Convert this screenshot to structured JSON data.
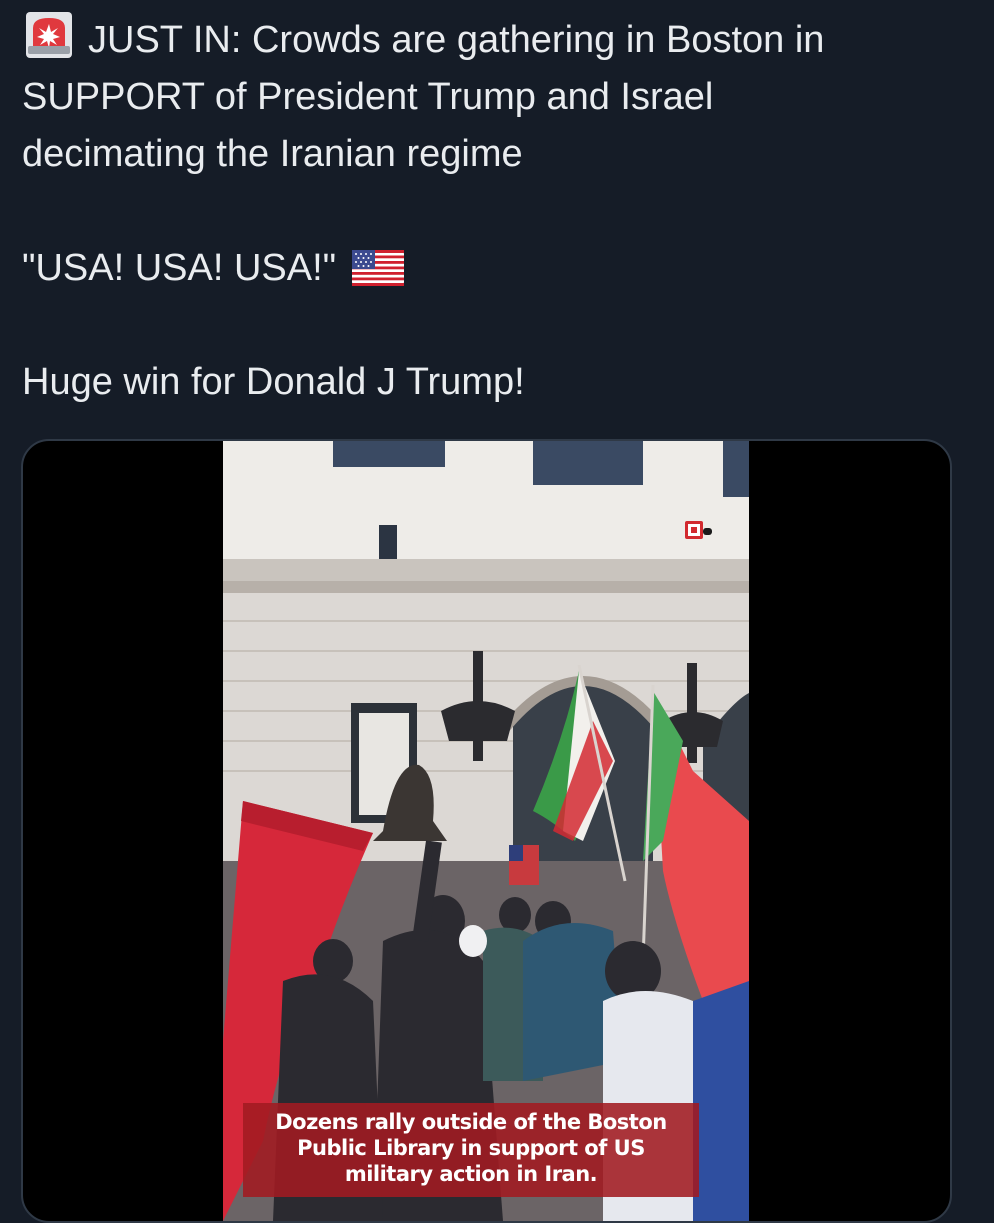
{
  "tweet": {
    "line1_prefix_icon": "police-siren-emoji",
    "line1": "JUST IN: Crowds are gathering in Boston in",
    "line2": "SUPPORT of President Trump and Israel",
    "line3": "decimating the Iranian regime",
    "chant": "\"USA! USA! USA!\"",
    "chant_suffix_icon": "us-flag-emoji",
    "closing": "Huge win for Donald J Trump!"
  },
  "media": {
    "type": "video",
    "caption": "Dozens rally outside of the Boston Public Library in support of US military action in Iran.",
    "watermark_icon": "news-outlet-logo-icon"
  },
  "colors": {
    "background": "#151c27",
    "text": "#e9ecef",
    "caption_bg": "#a21a21"
  }
}
